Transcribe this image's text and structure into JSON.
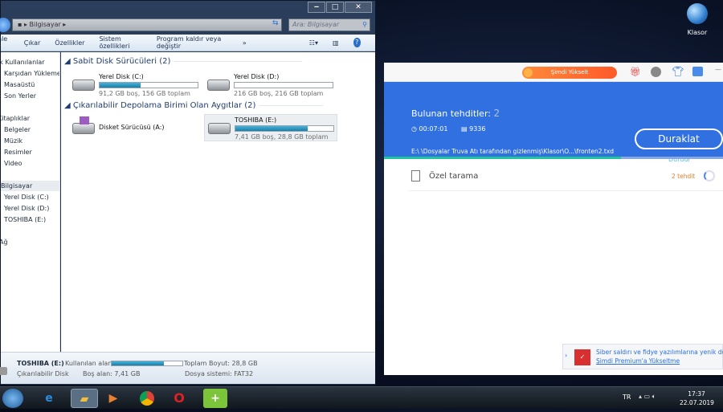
{
  "explorer": {
    "address": "Bilgisayar",
    "search_placeholder": "Ara: Bilgisayar",
    "toolbar": [
      "nle ▾",
      "Çıkar",
      "Özellikler",
      "Sistem özellikleri",
      "Program kaldır veya değiştir",
      "»"
    ],
    "nav": [
      "ık Kullanılanlar",
      "Karşıdan Yüklemeler",
      "Masaüstü",
      "Son Yerler",
      "Kitaplıklar",
      "Belgeler",
      "Müzik",
      "Resimler",
      "Video",
      "Bilgisayar",
      "Yerel Disk (C:)",
      "Yerel Disk (D:)",
      "TOSHIBA (E:)",
      "Ağ"
    ],
    "group_fixed": "Sabit Disk Sürücüleri (2)",
    "group_removable": "Çıkarılabilir Depolama Birimi Olan Aygıtlar (2)",
    "drives": [
      {
        "name": "Yerel Disk (C:)",
        "info": "91,2 GB boş, 156 GB toplam",
        "used_pct": 42
      },
      {
        "name": "Yerel Disk (D:)",
        "info": "216 GB boş, 216 GB toplam",
        "used_pct": 0
      },
      {
        "name": "Disket Sürücüsü (A:)"
      },
      {
        "name": "TOSHIBA (E:)",
        "info": "7,41 GB boş, 28,8 GB toplam",
        "used_pct": 74
      }
    ],
    "status": {
      "name": "TOSHIBA (E:)",
      "type": "Çıkarılabilir Disk",
      "used_label": "Kullanılan alan:",
      "free": "Boş alan: 7,41 GB",
      "total": "Toplam Boyut: 28,8 GB",
      "fs": "Dosya sistemi: FAT32",
      "used_pct": 74
    }
  },
  "desktop": {
    "icon_label": "Klasor"
  },
  "av": {
    "upgrade": "Şimdi Yükselt",
    "threats_label": "Bulunan tehditler:",
    "threats_count": "2",
    "time": "00:07:01",
    "files": "9336",
    "pause": "Duraklat",
    "stop": "Durdur",
    "path": "E:\\ \\Dosyalar Truva Atı tarafından gizlenmiş\\Klasor\\O...\\fronten2.txd",
    "progress_pct": 70,
    "scan_name": "Özel tarama",
    "scan_threats": "2 tehdit",
    "notice_line1": "Siber saldırı ve fidye yazılımlarına yenik dü",
    "notice_link": "Şimdi Premium'a Yükseltme"
  },
  "taskbar": {
    "lang": "TR",
    "time": "17:37",
    "date": "22.07.2019"
  },
  "colors": {
    "av_blue": "#3070e0",
    "progress": "#22c49a",
    "threat_orange": "#e08030"
  }
}
